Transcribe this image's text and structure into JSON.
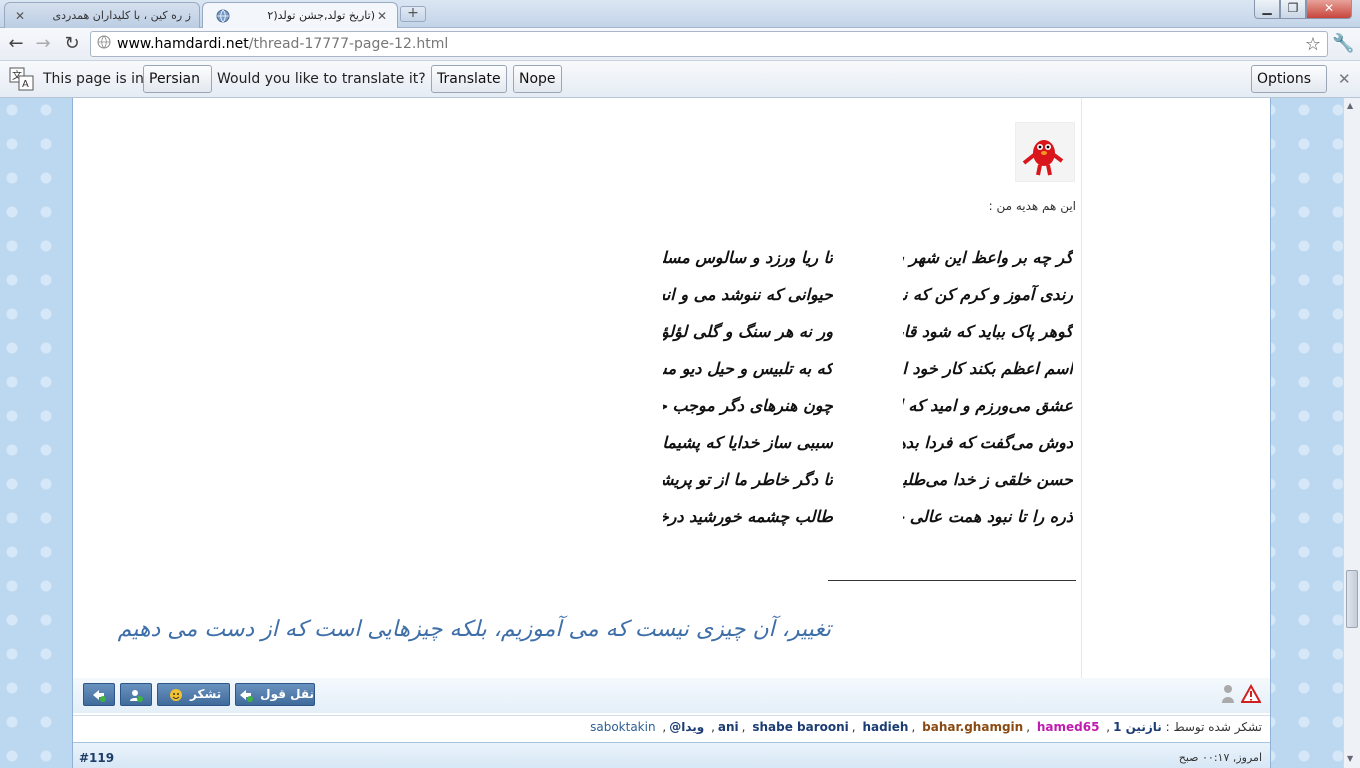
{
  "browser": {
    "tabs": [
      {
        "title": "ز ره کین ، با کلیداران همدردی",
        "active": false
      },
      {
        "title": "(تاریخ تولد,جشن تولد(۲",
        "active": true
      }
    ],
    "new_tab_symbol": "+",
    "window_controls": {
      "minimize": "▁",
      "maximize": "❐",
      "close": "✕"
    },
    "url_host": "www.hamdardi.net",
    "url_path": "/thread-17777-page-12.html"
  },
  "translate_bar": {
    "prefix": "This page is in",
    "language": "Persian",
    "question": "Would you like to translate it?",
    "translate_label": "Translate",
    "nope_label": "Nope",
    "options_label": "Options"
  },
  "post": {
    "intro": "این هم هدیه من :",
    "poem": [
      [
        "گر چه بر واعظ این شهر سخن آسان نشود",
        "تا ریا ورزد و سالوس مسلمان نشود"
      ],
      [
        "رندی آموز و کرم کن که نه چندان هنر است",
        "حیوانی که ننوشد می و انسان نشود"
      ],
      [
        "گوهر پاک بباید که شود قابل فیض",
        "ور نه هر سنگ و گلی لؤلؤ و مرجان نشود"
      ],
      [
        "اسم اعظم بکند کار خود ای دل خوش باش",
        "که به تلبیس و حیل دیو مسلمان نشود"
      ],
      [
        "عشق می‌ورزم و امید که این فن شریف",
        "چون هنرهای دگر موجب حرمان نشود"
      ],
      [
        "دوش می‌گفت که فردا بدهم کام دلت",
        "سببی ساز خدایا که پشیمان نشود"
      ],
      [
        "حسن خلقی ز خدا می‌طلبم خوی ترا",
        "تا دگر خاطر ما از تو پریشان نشود"
      ],
      [
        "ذره را تا نبود همت عالی حافظ",
        "طالب چشمه خورشید درخشان نشود"
      ]
    ],
    "signature": "تغییر، آن چیزی نیست که می آموزیم، بلکه چیزهایی است که از دست می دهیم"
  },
  "actions": {
    "quote_label": "نقل قول",
    "thanks_label": "تشکر"
  },
  "thanks": {
    "label": "تشکر شده توسط :",
    "users": [
      {
        "name": "نازنین 1",
        "style": "bold"
      },
      {
        "name": "ani",
        "style": "bold"
      },
      {
        "name": "shabe barooni",
        "style": "bold"
      },
      {
        "name": "hadieh",
        "style": "bold"
      },
      {
        "name": "bahar.ghamgin",
        "style": "brown"
      },
      {
        "name": "hamed65",
        "style": "pink"
      },
      {
        "name": "ویدا@",
        "style": "bold"
      },
      {
        "name": "saboktakin",
        "style": "plain"
      }
    ]
  },
  "next_post": {
    "number": "#119",
    "date": "امروز, ۰۰:۱۷ صبح"
  },
  "colors": {
    "accent": "#3f6b9c",
    "signature": "#3e6fa8",
    "page_bg": "#bcd8f1"
  }
}
